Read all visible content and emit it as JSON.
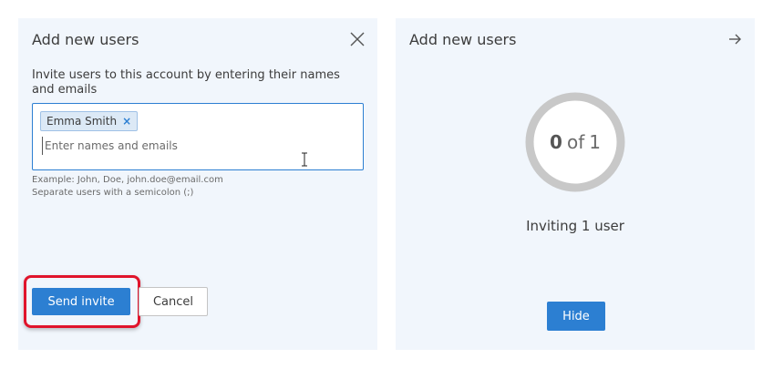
{
  "left_panel": {
    "title": "Add new users",
    "description": "Invite users to this account by entering their names and emails",
    "chips": [
      {
        "label": "Emma Smith",
        "remove_symbol": "×"
      }
    ],
    "input": {
      "value": "",
      "placeholder": "Enter names and emails"
    },
    "hint_example": "Example: John, Doe, john.doe@email.com",
    "hint_separator": "Separate users with a semicolon (;)",
    "send_label": "Send invite",
    "cancel_label": "Cancel",
    "close_icon": "close-icon"
  },
  "right_panel": {
    "title": "Add new users",
    "arrow_icon": "arrow-right-icon",
    "progress": {
      "done": "0",
      "of_word": "of",
      "total": "1",
      "fraction": 0
    },
    "status": "Inviting 1 user",
    "hide_label": "Hide"
  },
  "colors": {
    "accent": "#2c7fd2",
    "panel_bg": "#f1f6fc",
    "highlight": "#e0142b",
    "ring": "#c8c8c8"
  }
}
